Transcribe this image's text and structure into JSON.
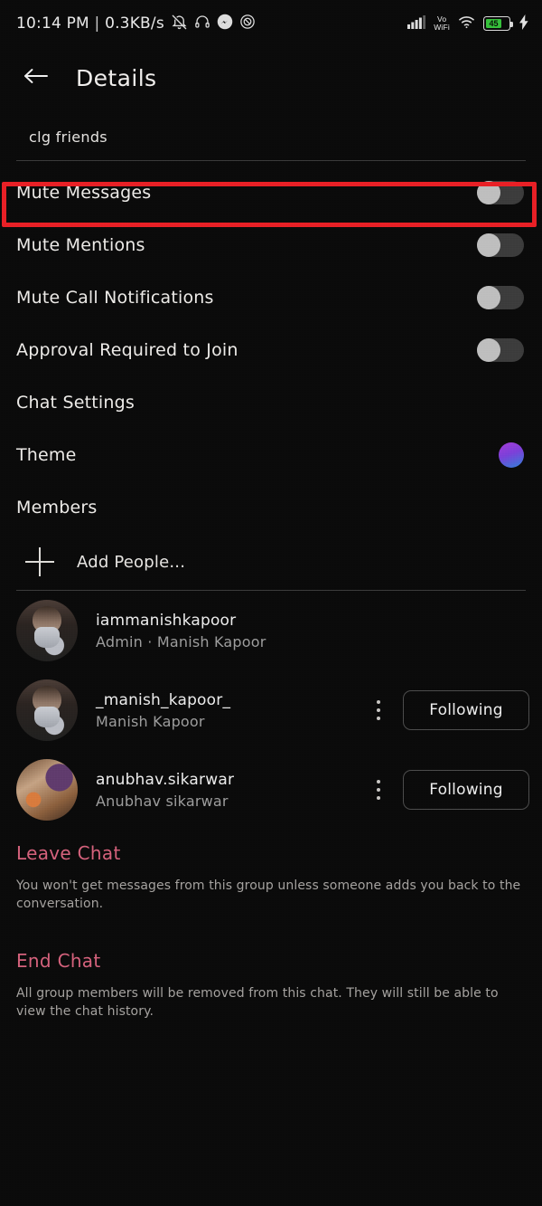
{
  "status_bar": {
    "time": "10:14 PM",
    "separator": "|",
    "network_speed": "0.3KB/s",
    "left_icons": [
      "bell-muted-icon",
      "headphones-icon",
      "messenger-icon",
      "do-not-disturb-icon"
    ],
    "signal_icon": "cellular-signal-icon",
    "volte_label_line1": "Vo",
    "volte_label_line2": "WiFi",
    "wifi_icon": "wifi-icon",
    "battery_level": "45",
    "charging_icon": "charging-bolt-icon"
  },
  "header": {
    "back_icon": "back-arrow-icon",
    "title": "Details"
  },
  "group": {
    "name": "clg friends"
  },
  "settings": {
    "rows": [
      {
        "label": "Mute Messages",
        "type": "toggle",
        "value": "off",
        "highlighted": true
      },
      {
        "label": "Mute Mentions",
        "type": "toggle",
        "value": "off",
        "highlighted": false
      },
      {
        "label": "Mute Call Notifications",
        "type": "toggle",
        "value": "off",
        "highlighted": false
      },
      {
        "label": "Approval Required to Join",
        "type": "toggle",
        "value": "off",
        "highlighted": false
      },
      {
        "label": "Chat Settings",
        "type": "link",
        "value": "",
        "highlighted": false
      },
      {
        "label": "Theme",
        "type": "swatch",
        "value": "gradient",
        "highlighted": false
      },
      {
        "label": "Members",
        "type": "link",
        "value": "",
        "highlighted": false
      }
    ]
  },
  "add_people": {
    "icon": "plus-icon",
    "label": "Add People..."
  },
  "members": [
    {
      "username": "iammanishkapoor",
      "subtitle": "Admin · Manish Kapoor",
      "avatar": "person-mask-avatar",
      "has_menu": false,
      "action_label": ""
    },
    {
      "username": "_manish_kapoor_",
      "subtitle": "Manish Kapoor",
      "avatar": "person-mask-avatar",
      "has_menu": true,
      "action_label": "Following"
    },
    {
      "username": "anubhav.sikarwar",
      "subtitle": "Anubhav sikarwar",
      "avatar": "group-photo-avatar",
      "has_menu": true,
      "action_label": "Following"
    }
  ],
  "leave_chat": {
    "title": "Leave Chat",
    "description": "You won't get messages from this group unless someone adds you back to the conversation."
  },
  "end_chat": {
    "title": "End Chat",
    "description": "All group members will be removed from this chat. They will still be able to view the chat history."
  },
  "colors": {
    "background": "#0a0a0a",
    "highlight_red": "#e81f25",
    "danger_text": "#d4607a",
    "battery_green": "#35c13a",
    "toggle_track": "#3b3b3b",
    "toggle_knob": "#bdbdbd"
  }
}
